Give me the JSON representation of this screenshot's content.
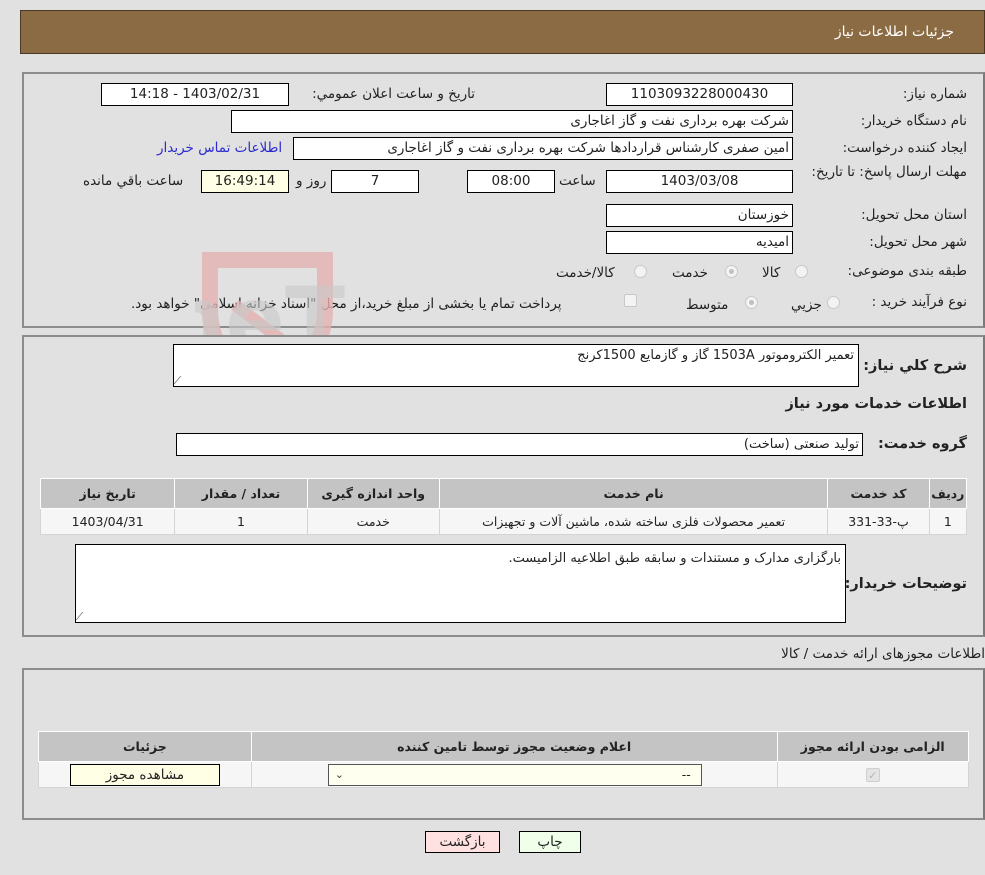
{
  "title": "جزئیات اطلاعات نیاز",
  "fields": {
    "need_number_label": "شماره نیاز:",
    "need_number": "1103093228000430",
    "announce_label": "تاریخ و ساعت اعلان عمومي:",
    "announce_value": "1403/02/31 - 14:18",
    "buyer_org_label": "نام دستگاه خریدار:",
    "buyer_org": "شرکت بهره برداری نفت و گاز اغاجاری",
    "creator_label": "ایجاد کننده درخواست:",
    "creator": "امین صفری کارشناس قراردادها شرکت بهره برداری نفت و گاز اغاجاری",
    "contact_link": "اطلاعات تماس خریدار",
    "deadline_label": "مهلت ارسال پاسخ: تا تاریخ:",
    "deadline_date": "1403/03/08",
    "time_label": "ساعت",
    "deadline_time": "08:00",
    "days": "7",
    "days_label": "روز و",
    "remaining_time": "16:49:14",
    "remaining_label": "ساعت باقي مانده",
    "province_label": "استان محل تحویل:",
    "province": "خوزستان",
    "city_label": "شهر محل تحویل:",
    "city": "امیدیه",
    "category_label": "طبقه بندی موضوعی:",
    "category_options": [
      "کالا",
      "خدمت",
      "کالا/خدمت"
    ],
    "category_selected": "خدمت",
    "process_label": "نوع فرآیند خرید :",
    "process_options": [
      "جزيي",
      "متوسط"
    ],
    "process_selected": "متوسط",
    "treasury_note": "پرداخت تمام یا بخشی از مبلغ خرید،از محل \"اسناد خزانه اسلامی\" خواهد بود."
  },
  "description": {
    "label": "شرح کلي نیاز:",
    "value": "تعمیر الکتروموتور 1503A گاز و گازمایع 1500کرنج"
  },
  "services": {
    "heading": "اطلاعات خدمات مورد نیاز",
    "group_label": "گروه خدمت:",
    "group_value": "تولید صنعتی (ساخت)",
    "columns": [
      "ردیف",
      "کد خدمت",
      "نام خدمت",
      "واحد اندازه گیری",
      "تعداد / مقدار",
      "تاریخ نیاز"
    ],
    "rows": [
      [
        "1",
        "پ-33-331",
        "تعمیر محصولات فلزی ساخته شده، ماشین آلات و تجهیزات",
        "خدمت",
        "1",
        "1403/04/31"
      ]
    ]
  },
  "buyer_notes": {
    "label": "توضیحات خریدار:",
    "value": "بارگزاری مدارک و مستندات و سابقه طبق اطلاعیه الزامیست."
  },
  "permits": {
    "heading": "اطلاعات مجوزهای ارائه خدمت / کالا",
    "columns": [
      "الزامی بودن ارائه مجوز",
      "اعلام وضعیت مجوز توسط تامین کننده",
      "جزئیات"
    ],
    "row": {
      "required": true,
      "status_selected": "--",
      "details_button": "مشاهده مجوز"
    }
  },
  "buttons": {
    "print": "چاپ",
    "back": "بازگشت"
  },
  "watermark": "AriaTender.neT"
}
